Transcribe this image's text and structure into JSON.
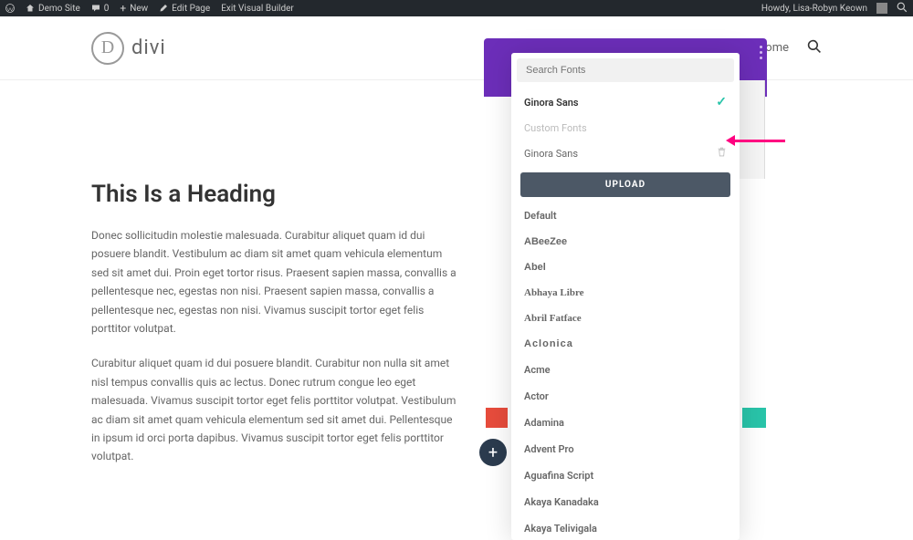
{
  "admin_bar": {
    "site_name": "Demo Site",
    "comments": "0",
    "new": "New",
    "edit_page": "Edit Page",
    "exit_builder": "Exit Visual Builder",
    "howdy": "Howdy, Lisa-Robyn Keown"
  },
  "logo": {
    "letter": "D",
    "text": "divi"
  },
  "nav": {
    "home": "ome"
  },
  "content": {
    "heading": "This Is a Heading",
    "p1": "Donec sollicitudin molestie malesuada. Curabitur aliquet quam id dui posuere blandit. Vestibulum ac diam sit amet quam vehicula elementum sed sit amet dui. Proin eget tortor risus. Praesent sapien massa, convallis a pellentesque nec, egestas non nisi. Praesent sapien massa, convallis a pellentesque nec, egestas non nisi. Vivamus suscipit tortor eget felis porttitor volutpat.",
    "p2": "Curabitur aliquet quam id dui posuere blandit. Curabitur non nulla sit amet nisl tempus convallis quis ac lectus. Donec rutrum congue leo eget malesuada. Vivamus suscipit tortor eget felis porttitor volutpat. Vestibulum ac diam sit amet quam vehicula elementum sed sit amet dui. Pellentesque in ipsum id orci porta dapibus. Vivamus suscipit tortor eget felis porttitor volutpat."
  },
  "font_picker": {
    "search_placeholder": "Search Fonts",
    "selected": "Ginora Sans",
    "custom_label": "Custom Fonts",
    "custom_font": "Ginora Sans",
    "upload": "UPLOAD",
    "fonts": [
      "Default",
      "ABeeZee",
      "Abel",
      "Abhaya Libre",
      "Abril Fatface",
      "Aclonica",
      "Acme",
      "Actor",
      "Adamina",
      "Advent Pro",
      "Aguafina Script",
      "Akaya Kanadaka",
      "Akaya Telivigala"
    ]
  }
}
